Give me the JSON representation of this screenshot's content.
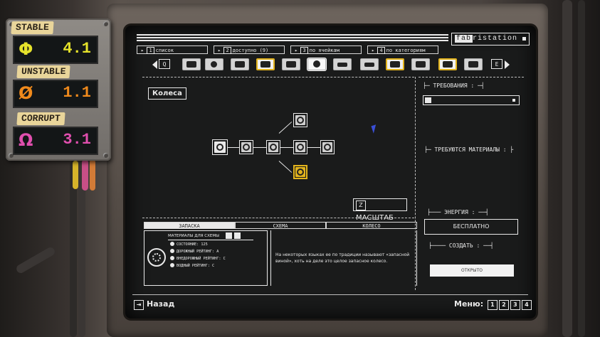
{
  "meters": [
    {
      "label": "STABLE",
      "symbol": "Φ",
      "value": "4.1",
      "color": "#e5e22b"
    },
    {
      "label": "UNSTABLE",
      "symbol": "Ø",
      "value": "1.1",
      "color": "#f08a1c"
    },
    {
      "label": "CORRUPT",
      "symbol": "Ω",
      "value": "3.1",
      "color": "#e04fae"
    }
  ],
  "brand": {
    "prefix": "fab",
    "suffix": "ristation"
  },
  "top_tabs": [
    {
      "key": "1",
      "label": "список"
    },
    {
      "key": "2",
      "label": "доступно (9)"
    },
    {
      "key": "3",
      "label": "по ячейкам"
    },
    {
      "key": "4",
      "label": "по категориям"
    }
  ],
  "category_bar": {
    "prev_key": "Q",
    "next_key": "E",
    "icons": [
      "bag-icon",
      "gear-icon",
      "tools-icon",
      "lamp-icon",
      "monitor-icon",
      "tire-icon",
      "car-icon",
      "car-alt-icon",
      "engine-icon",
      "radio-icon",
      "seat-icon",
      "cart-icon"
    ],
    "active_index": 3,
    "accent": "#e2b31c"
  },
  "schematic": {
    "title": "Колеса",
    "zoom_key": "Z",
    "zoom_label": "МАСШТАБ"
  },
  "bottom_tabs": {
    "tabs": [
      "ЗАПАСКА",
      "СХЕМА",
      "КОЛЕСО"
    ],
    "active": 0
  },
  "part": {
    "materials_header": "МАТЕРИАЛЫ ДЛЯ СХЕМЫ",
    "stats": [
      {
        "label": "СОСТОЯНИЕ:",
        "value": "125"
      },
      {
        "label": "ДОРОЖНЫЙ РЕЙТИНГ:",
        "value": "А"
      },
      {
        "label": "ВНЕДОРОЖНЫЙ РЕЙТИНГ:",
        "value": "С"
      },
      {
        "label": "ВОДНЫЙ РЕЙТИНГ:",
        "value": "С"
      }
    ],
    "description": "На некоторых языках ее по традиции называют «запасной виной», хоть на деле это целое запасное колесо."
  },
  "right_panel": {
    "requirements": "ТРЕБОВАНИЯ :",
    "materials_required": "ТРЕБУЮТСЯ МАТЕРИАЛЫ :",
    "energy": "ЭНЕРГИЯ :",
    "energy_value": "БЕСПЛАТНО",
    "create": "СОЗДАТЬ :",
    "open_button": "ОТКРЫТО"
  },
  "footer": {
    "back_label": "Назад",
    "menu_label": "Меню:",
    "menu_keys": [
      "1",
      "2",
      "3",
      "4"
    ]
  }
}
